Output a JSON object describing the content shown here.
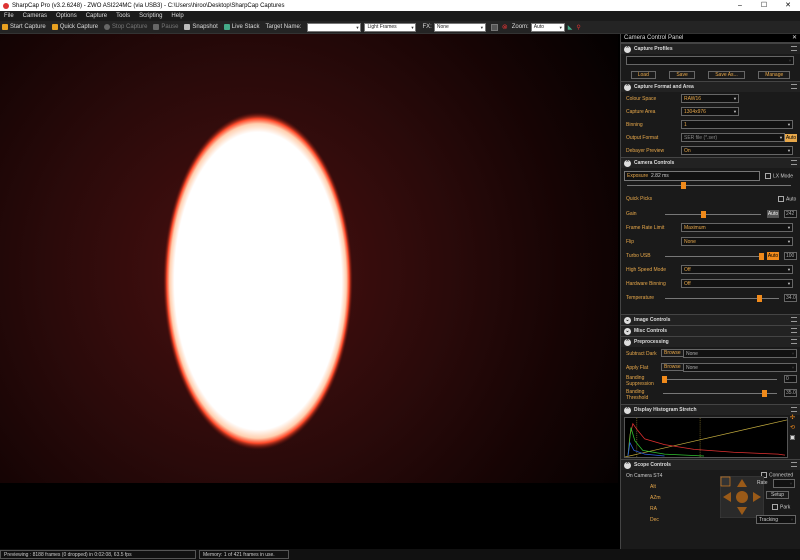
{
  "window": {
    "title": "SharpCap Pro (v3.2.6248) - ZWO ASI224MC (via USB3) - C:\\Users\\hiroo\\Desktop\\SharpCap Captures"
  },
  "menu": [
    "File",
    "Cameras",
    "Options",
    "Capture",
    "Tools",
    "Scripting",
    "Help"
  ],
  "toolbar": {
    "start_capture": "Start Capture",
    "quick_capture": "Quick Capture",
    "stop_capture": "Stop Capture",
    "pause": "Pause",
    "snapshot": "Snapshot",
    "live_stack": "Live Stack",
    "target_name_label": "Target Name:",
    "target_name_value": "",
    "frame_type": "Light Frames",
    "fx_label": "FX:",
    "fx_value": "None",
    "zoom_label": "Zoom:",
    "zoom_value": "Auto"
  },
  "panel": {
    "title": "Camera Control Panel",
    "capture_profiles": {
      "header": "Capture Profiles",
      "profile_value": "",
      "buttons": [
        "Load",
        "Save",
        "Save As...",
        "Manage"
      ]
    },
    "capture_format": {
      "header": "Capture Format and Area",
      "rows": [
        {
          "label": "Colour Space",
          "value": "RAW16"
        },
        {
          "label": "Capture Area",
          "value": "1304x976"
        },
        {
          "label": "Binning",
          "value": "1"
        },
        {
          "label": "Output Format",
          "value": "SER file (*.ser)"
        },
        {
          "label": "Debayer Preview",
          "value": "On"
        }
      ],
      "auto_label": "Auto"
    },
    "camera_controls": {
      "header": "Camera Controls",
      "exposure_label": "Exposure",
      "exposure_value": "2.82 ms",
      "lx_mode": "LX Mode",
      "quick_picks": "Quick Picks",
      "auto": "Auto",
      "gain_label": "Gain",
      "gain_value": "242",
      "frame_rate_label": "Frame Rate Limit",
      "frame_rate_value": "Maximum",
      "flip_label": "Flip",
      "flip_value": "None",
      "turbo_label": "Turbo USB",
      "turbo_value": "100",
      "high_speed_label": "High Speed Mode",
      "high_speed_value": "Off",
      "hw_binning_label": "Hardware Binning",
      "hw_binning_value": "Off",
      "temperature_label": "Temperature",
      "temperature_value": "34.0"
    },
    "image_controls": {
      "header": "Image Controls"
    },
    "misc_controls": {
      "header": "Misc Controls"
    },
    "preprocessing": {
      "header": "Preprocessing",
      "subtract_dark_label": "Subtract Dark",
      "apply_flat_label": "Apply Flat",
      "browse": "Browse",
      "none": "None",
      "banding_suppression_label": "Banding Suppression",
      "banding_suppression_value": "0",
      "banding_threshold_label": "Banding Threshold",
      "banding_threshold_value": "35.0"
    },
    "histogram": {
      "header": "Display Histogram Stretch"
    },
    "scope": {
      "header": "Scope Controls",
      "mount": "On Camera ST4",
      "connected": "Connected",
      "alt": "Alt",
      "azm": "AZm",
      "ra": "RA",
      "dec": "Dec",
      "rate_label": "Rate",
      "setup": "Setup",
      "park": "Park",
      "tracking": "Tracking"
    }
  },
  "status": {
    "preview": "Previewing : 8188 frames (0 dropped) in 0:02:08, 63.5 fps",
    "memory": "Memory: 1 of 421 frames in use."
  }
}
